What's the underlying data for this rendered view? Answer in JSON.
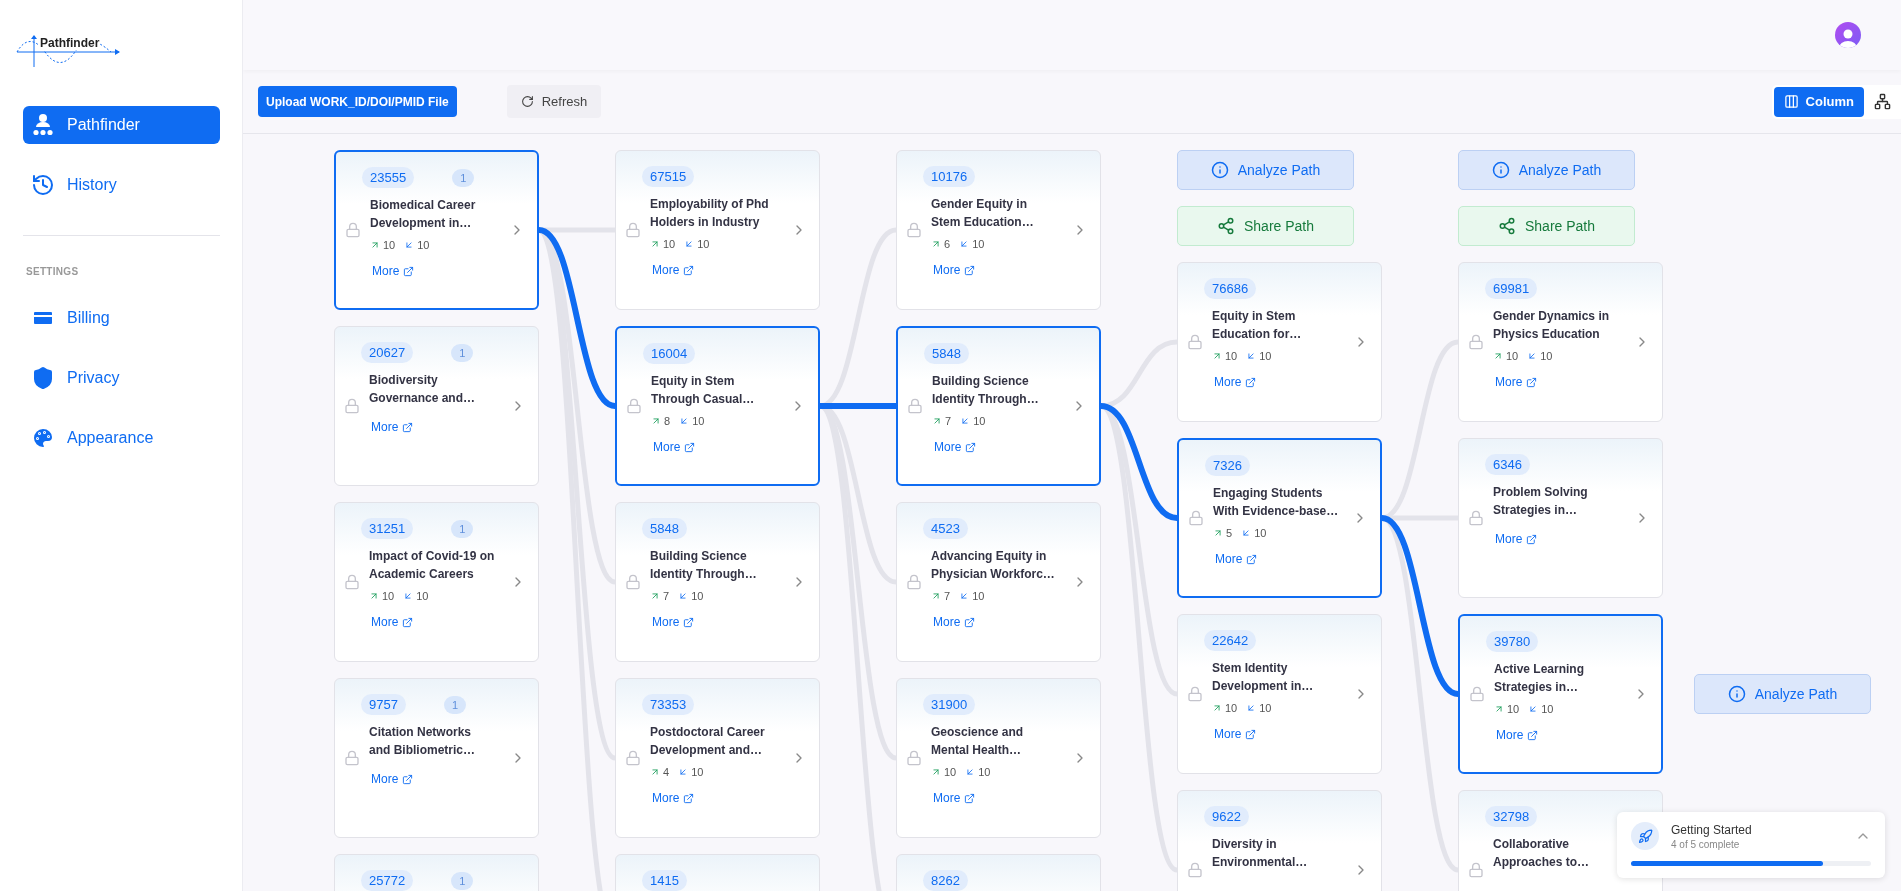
{
  "sidebar": {
    "logo": "Pathfinder",
    "nav": [
      {
        "kind": "team",
        "label": "Pathfinder",
        "selected": true
      },
      {
        "kind": "history",
        "label": "History",
        "selected": false
      }
    ],
    "settings_heading": "SETTINGS",
    "settings": [
      {
        "kind": "billing",
        "label": "Billing",
        "selected": false
      },
      {
        "kind": "privacy",
        "label": "Privacy",
        "selected": false
      },
      {
        "kind": "appearance",
        "label": "Appearance",
        "selected": false
      }
    ]
  },
  "toolbar": {
    "upload": "Upload WORK_ID/DOI/PMID File",
    "refresh": "Refresh",
    "views": [
      {
        "kind": "column",
        "label": "Column",
        "selected": true
      },
      {
        "kind": "network",
        "selected": false
      }
    ]
  },
  "columns": [
    {
      "cards": [
        {
          "id": "23555",
          "badge": "1",
          "title": "Biomedical Career Development in…",
          "cited": "10",
          "refs": "10",
          "more": "More",
          "selected": true
        },
        {
          "id": "20627",
          "badge": "1",
          "title": "Biodiversity Governance and…",
          "more": "More",
          "selected": false
        },
        {
          "id": "31251",
          "badge": "1",
          "title": "Impact of Covid-19 on Academic Careers",
          "cited": "10",
          "refs": "10",
          "more": "More",
          "selected": false
        },
        {
          "id": "9757",
          "badge": "1",
          "title": "Citation Networks and Bibliometric…",
          "more": "More",
          "selected": false
        },
        {
          "id": "25772",
          "badge": "1",
          "selected": false
        }
      ]
    },
    {
      "cards": [
        {
          "id": "67515",
          "title": "Employability of Phd Holders in Industry",
          "cited": "10",
          "refs": "10",
          "more": "More",
          "selected": false
        },
        {
          "id": "16004",
          "title": "Equity in Stem Through Casual…",
          "cited": "8",
          "refs": "10",
          "more": "More",
          "selected": true
        },
        {
          "id": "5848",
          "title": "Building Science Identity Through…",
          "cited": "7",
          "refs": "10",
          "more": "More",
          "selected": false
        },
        {
          "id": "73353",
          "title": "Postdoctoral Career Development and…",
          "cited": "4",
          "refs": "10",
          "more": "More",
          "selected": false
        },
        {
          "id": "1415",
          "selected": false
        }
      ]
    },
    {
      "cards": [
        {
          "id": "10176",
          "title": "Gender Equity in Stem Education…",
          "cited": "6",
          "refs": "10",
          "more": "More",
          "selected": false
        },
        {
          "id": "5848",
          "title": "Building Science Identity Through…",
          "cited": "7",
          "refs": "10",
          "more": "More",
          "selected": true
        },
        {
          "id": "4523",
          "title": "Advancing Equity in Physician Workforc…",
          "cited": "7",
          "refs": "10",
          "more": "More",
          "selected": false
        },
        {
          "id": "31900",
          "title": "Geoscience and Mental Health…",
          "cited": "10",
          "refs": "10",
          "more": "More",
          "selected": false
        },
        {
          "id": "8262",
          "selected": false
        }
      ]
    },
    {
      "actions": [
        {
          "kind": "analyze",
          "label": "Analyze Path"
        },
        {
          "kind": "share",
          "label": "Share Path"
        }
      ],
      "cards": [
        {
          "id": "76686",
          "title": "Equity in Stem Education for…",
          "cited": "10",
          "refs": "10",
          "more": "More",
          "selected": false
        },
        {
          "id": "7326",
          "title": "Engaging Students With Evidence-base…",
          "cited": "5",
          "refs": "10",
          "more": "More",
          "selected": true
        },
        {
          "id": "22642",
          "title": "Stem Identity Development in…",
          "cited": "10",
          "refs": "10",
          "more": "More",
          "selected": false
        },
        {
          "id": "9622",
          "title": "Diversity in Environmental…",
          "selected": false
        }
      ]
    },
    {
      "actions": [
        {
          "kind": "analyze",
          "label": "Analyze Path"
        },
        {
          "kind": "share",
          "label": "Share Path"
        }
      ],
      "cards": [
        {
          "id": "69981",
          "title": "Gender Dynamics in Physics Education",
          "cited": "10",
          "refs": "10",
          "more": "More",
          "selected": false
        },
        {
          "id": "6346",
          "title": "Problem Solving Strategies in…",
          "more": "More",
          "selected": false
        },
        {
          "id": "39780",
          "title": "Active Learning Strategies in…",
          "cited": "10",
          "refs": "10",
          "more": "More",
          "selected": true
        },
        {
          "id": "32798",
          "title": "Collaborative Approaches to…",
          "selected": false
        }
      ]
    }
  ],
  "end_action": {
    "kind": "analyze",
    "label": "Analyze Path"
  },
  "getting_started": {
    "title": "Getting Started",
    "subtitle": "4 of 5 complete",
    "level": 0.8
  }
}
